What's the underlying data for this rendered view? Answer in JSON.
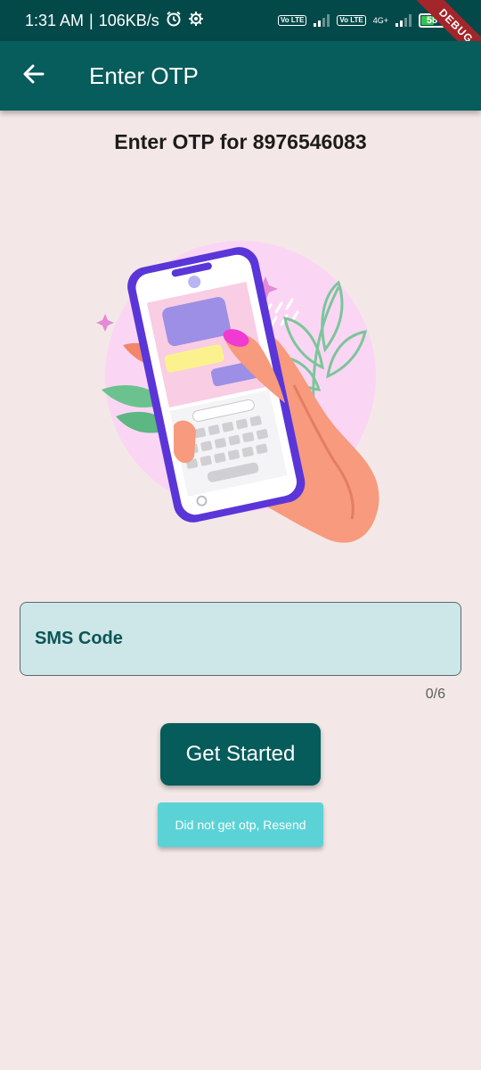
{
  "status_bar": {
    "time": "1:31 AM",
    "speed": "106KB/s",
    "volte1": "Vo LTE",
    "volte2": "Vo LTE",
    "network": "4G+",
    "battery": "58",
    "debug": "DEBUG"
  },
  "app_bar": {
    "title": "Enter OTP",
    "back_icon": "arrow-left-icon"
  },
  "heading": "Enter OTP for 8976546083",
  "otp_field": {
    "placeholder": "SMS Code",
    "value": "",
    "counter": "0/6"
  },
  "buttons": {
    "get_started": "Get Started",
    "resend": "Did not get otp, Resend"
  },
  "colors": {
    "app_bar": "#075c5c",
    "background": "#f3e8e7",
    "field_fill": "#cde6e7",
    "primary_button": "#065b5b",
    "resend_button": "#5bd3d6"
  }
}
